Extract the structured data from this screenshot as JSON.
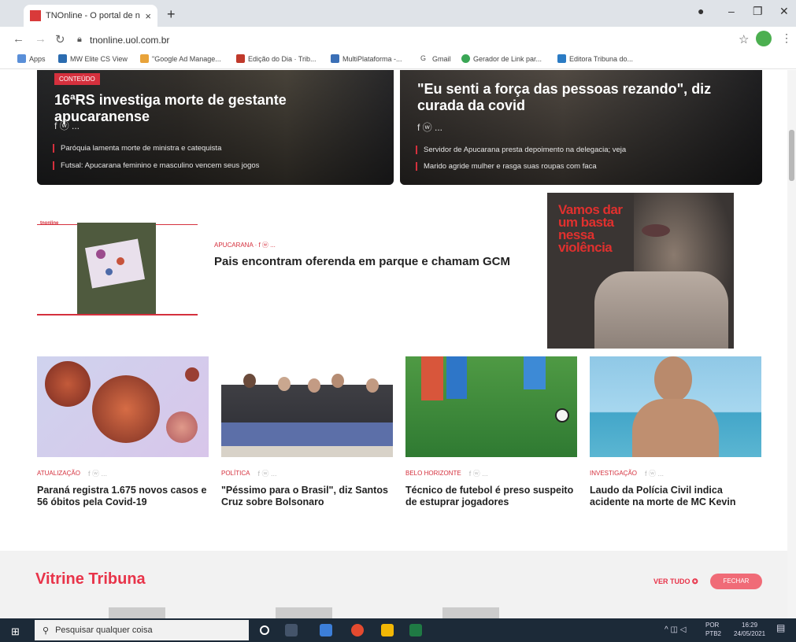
{
  "browser": {
    "tab_title": "TNOnline - O portal de notícias",
    "tab_close": "×",
    "new_tab": "+",
    "url": "tnonline.uol.com.br",
    "bookmarks": [
      "Apps",
      "MW Elite CS View",
      "\"Google Ad Manage...",
      "Edição do Dia · Trib...",
      "MultiPlataforma -...",
      "Gmail",
      "Gerador de Link par...",
      "Editora Tribuna do..."
    ]
  },
  "heroes": [
    {
      "tag": "CONTEÚDO",
      "title": "16ªRS investiga morte de gestante apucaranense",
      "share": "f  ⓦ ...",
      "related": [
        "Paróquia lamenta morte de ministra e catequista",
        "Futsal: Apucarana feminino e masculino vencem seus jogos"
      ]
    },
    {
      "title": "\"Eu senti a força das pessoas rezando\", diz curada da covid",
      "share": "f  ⓦ ...",
      "related": [
        "Servidor de Apucarana presta depoimento na delegacia; veja",
        "Marido agride mulher e rasga suas roupas com faca"
      ]
    }
  ],
  "featured": {
    "logo": "tnonline",
    "kicker": "APUCARANA  ·  f  ⓦ ...",
    "title": "Pais encontram oferenda em parque e chamam GCM"
  },
  "ad": {
    "text": "Vamos dar\num basta\nnessa\nviolência"
  },
  "cards": [
    {
      "kicker": "ATUALIZAÇÃO",
      "share": "f  ⓦ ...",
      "title": "Paraná registra 1.675 novos casos e 56 óbitos pela Covid-19"
    },
    {
      "kicker": "POLÍTICA",
      "share": "f  ⓦ ...",
      "title": "\"Péssimo para o Brasil\", diz Santos Cruz sobre Bolsonaro"
    },
    {
      "kicker": "BELO HORIZONTE",
      "share": "f  ⓦ ...",
      "title": "Técnico de futebol é preso suspeito de estuprar jogadores"
    },
    {
      "kicker": "INVESTIGAÇÃO",
      "share": "f  ⓦ ...",
      "title": "Laudo da Polícia Civil indica acidente na morte de MC Kevin"
    }
  ],
  "vitrine": {
    "title": "Vitrine Tribuna",
    "see_all": "VER TUDO ✪",
    "close": "FECHAR"
  },
  "taskbar": {
    "search_placeholder": "Pesquisar qualquer coisa",
    "lang": "POR\nPTB2",
    "time": "16:29\n24/05/2021"
  },
  "colors": {
    "accent": "#d5303d",
    "vitrine": "#e8344a",
    "taskbar": "#1c2a38"
  }
}
